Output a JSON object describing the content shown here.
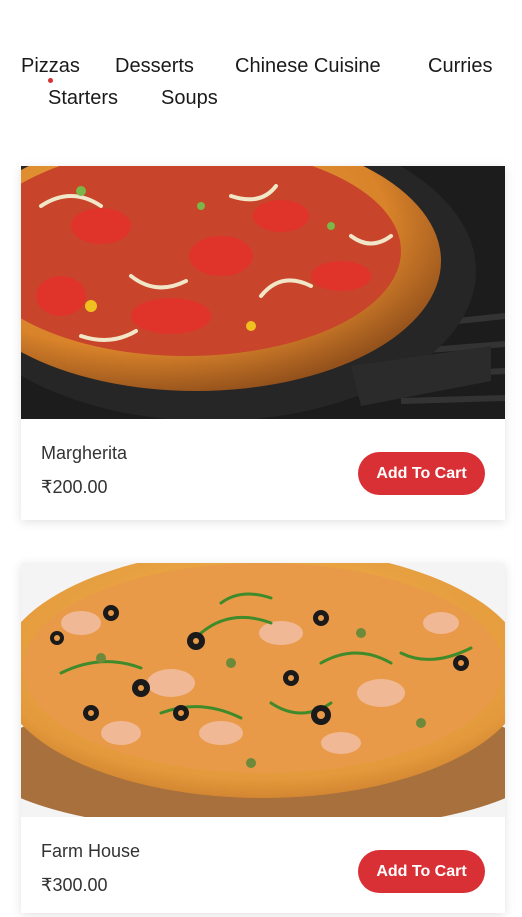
{
  "categories": [
    {
      "label": "Pizzas",
      "active": true
    },
    {
      "label": "Desserts"
    },
    {
      "label": "Chinese Cuisine"
    },
    {
      "label": "Curries"
    },
    {
      "label": "Starters"
    },
    {
      "label": "Soups"
    }
  ],
  "products": [
    {
      "name": "Margherita",
      "price": "₹200.00",
      "button_label": "Add To Cart",
      "image": "pizza-margherita-photo"
    },
    {
      "name": "Farm House",
      "price": "₹300.00",
      "button_label": "Add To Cart",
      "image": "pizza-farmhouse-photo"
    }
  ],
  "colors": {
    "accent": "#d93036",
    "text": "#1a1a1a"
  }
}
